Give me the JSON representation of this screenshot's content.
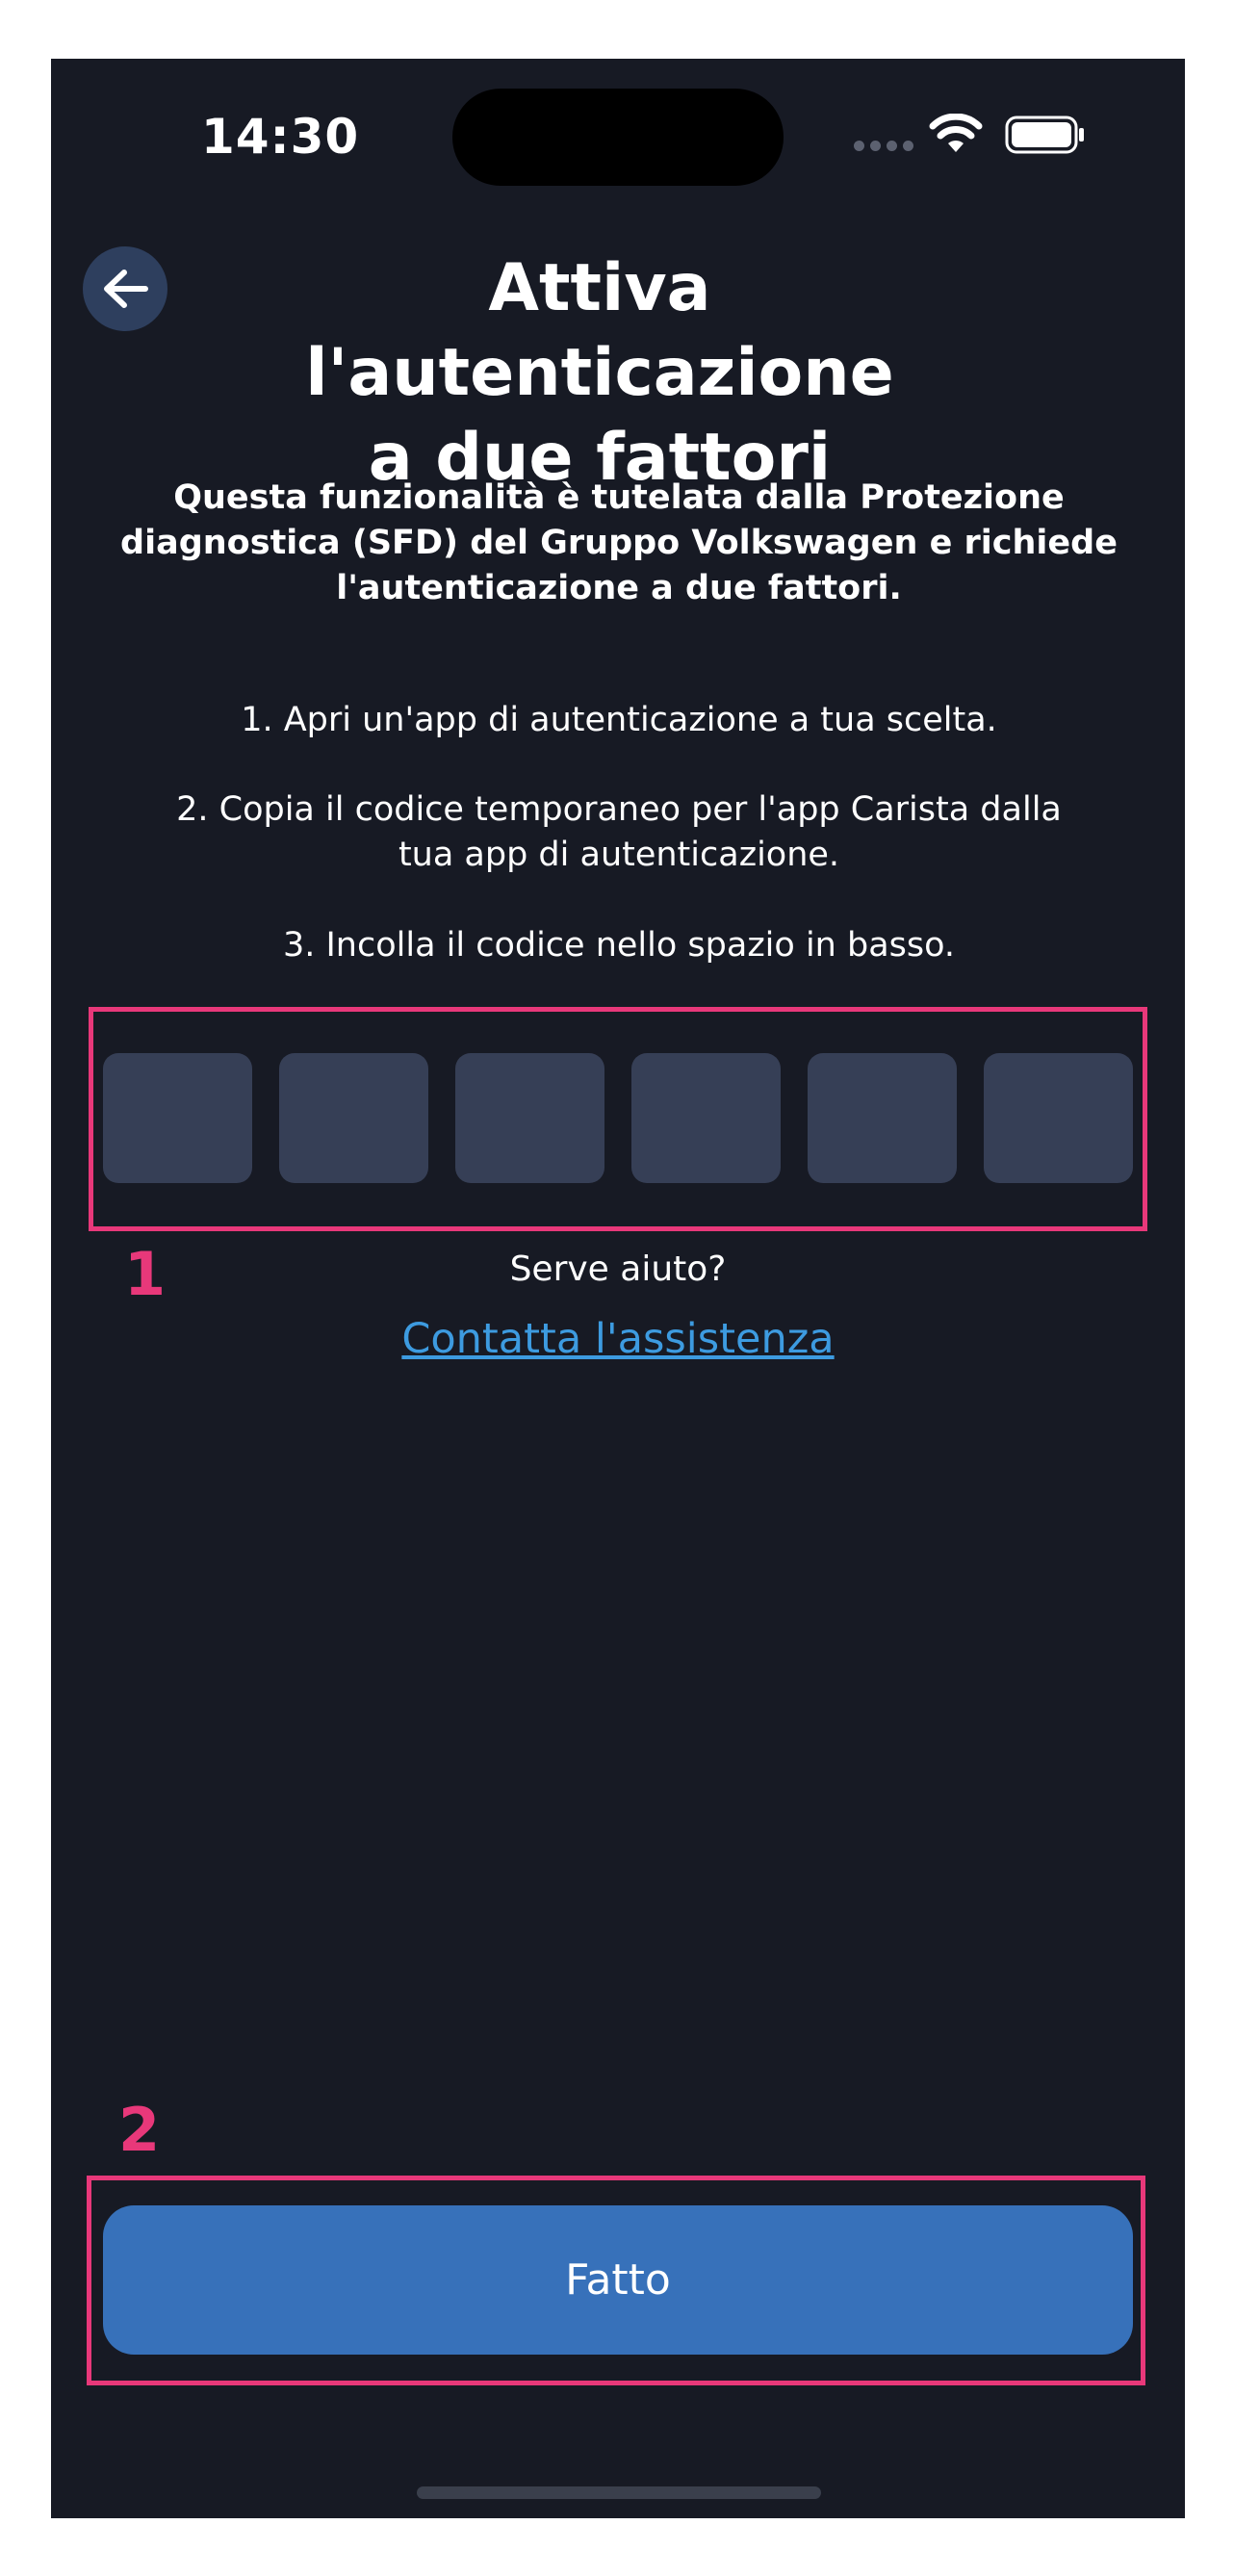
{
  "status_bar": {
    "time": "14:30"
  },
  "header": {
    "back_icon": "arrow-left-icon",
    "title_line1": "Attiva l'autenticazione",
    "title_line2": "a due fattori"
  },
  "description": {
    "line1": "Questa funzionalità è tutelata dalla Protezione",
    "line2": "diagnostica (SFD) del Gruppo Volkswagen e richiede",
    "line3": "l'autenticazione a due fattori."
  },
  "steps": {
    "step1": "1. Apri un'app di autenticazione a tua scelta.",
    "step2_line1": "2. Copia il codice temporaneo per l'app Carista dalla",
    "step2_line2": "tua app di autenticazione.",
    "step3": "3. Incolla il codice nello spazio in basso."
  },
  "code_input": {
    "digits": [
      "",
      "",
      "",
      "",
      "",
      ""
    ]
  },
  "help": {
    "question": "Serve aiuto?",
    "link": "Contatta l'assistenza"
  },
  "footer": {
    "done_label": "Fatto"
  },
  "annotations": {
    "label1": "1",
    "label2": "2"
  },
  "colors": {
    "background": "#171a24",
    "code_box": "#363f56",
    "button": "#3771ba",
    "link": "#3d9be0",
    "highlight": "#e8387a"
  }
}
